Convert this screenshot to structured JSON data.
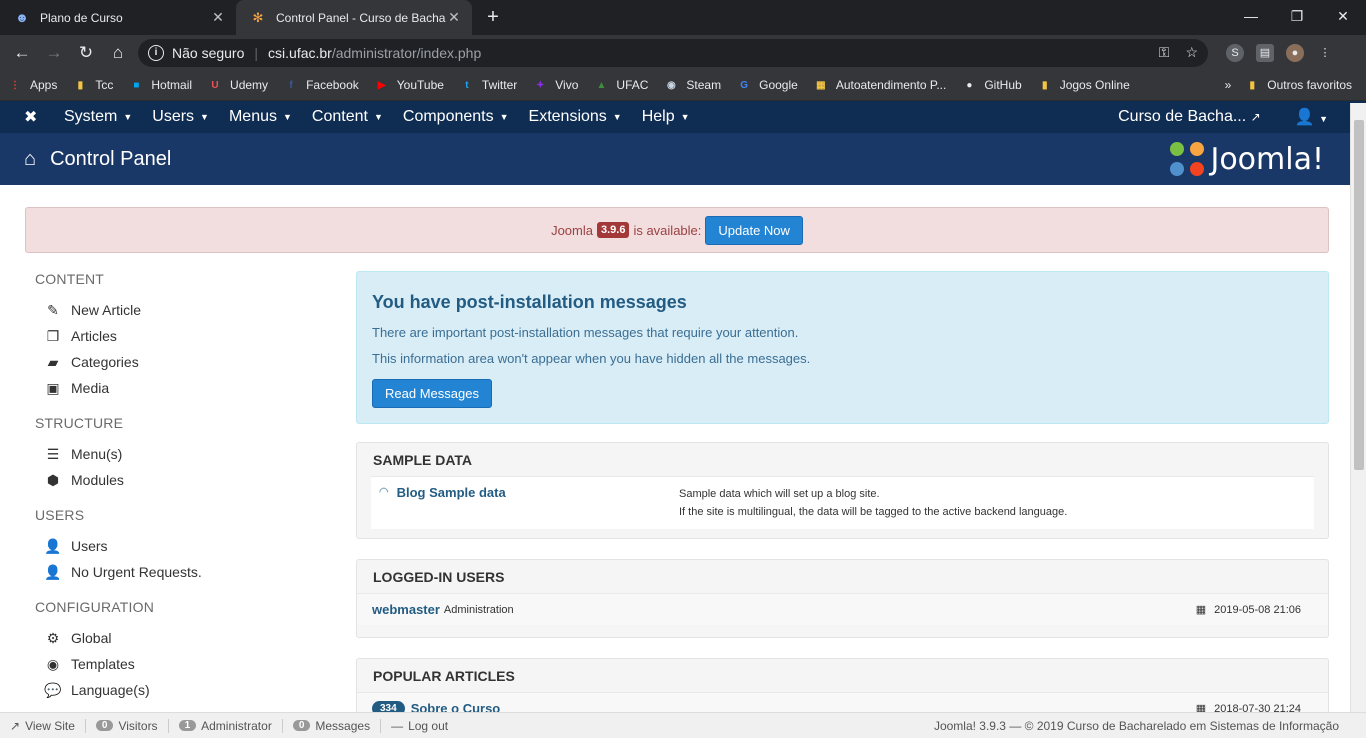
{
  "browser": {
    "tabs": [
      {
        "title": "Plano de Curso",
        "active": false
      },
      {
        "title": "Control Panel - Curso de Bachare",
        "active": true
      }
    ],
    "omnibox": {
      "security": "Não seguro",
      "host": "csi.ufac.br",
      "path": "/administrator/index.php"
    },
    "bookmarks": [
      {
        "label": "Apps",
        "icon": "apps-grid-icon",
        "color": "#ea4335"
      },
      {
        "label": "Tcc",
        "icon": "folder-icon",
        "color": "#f4c542"
      },
      {
        "label": "Hotmail",
        "icon": "microsoft-icon",
        "color": "#00a4ef"
      },
      {
        "label": "Udemy",
        "icon": "udemy-icon",
        "color": "#ec5252"
      },
      {
        "label": "Facebook",
        "icon": "facebook-icon",
        "color": "#3b5998"
      },
      {
        "label": "YouTube",
        "icon": "youtube-icon",
        "color": "#ff0000"
      },
      {
        "label": "Twitter",
        "icon": "twitter-icon",
        "color": "#1da1f2"
      },
      {
        "label": "Vivo",
        "icon": "vivo-icon",
        "color": "#8a2be2"
      },
      {
        "label": "UFAC",
        "icon": "ufac-icon",
        "color": "#3c8d3c"
      },
      {
        "label": "Steam",
        "icon": "steam-icon",
        "color": "#c7d5e0"
      },
      {
        "label": "Google",
        "icon": "google-icon",
        "color": "#4285f4"
      },
      {
        "label": "Autoatendimento P...",
        "icon": "autoatendimento-icon",
        "color": "#f4c542"
      },
      {
        "label": "GitHub",
        "icon": "github-icon",
        "color": "#e8eaed"
      },
      {
        "label": "Jogos Online",
        "icon": "bookmark-page-icon",
        "color": "#f4c542"
      }
    ],
    "more_label": "»",
    "other_bookmarks": "Outros favoritos"
  },
  "joomla": {
    "menu": [
      "System",
      "Users",
      "Menus",
      "Content",
      "Components",
      "Extensions",
      "Help"
    ],
    "site_link": "Curso de Bacha...",
    "page_title": "Control Panel",
    "brand": "Joomla!",
    "update": {
      "prefix": "Joomla",
      "version": "3.9.6",
      "suffix": "is available:",
      "button": "Update Now"
    },
    "sidebar": {
      "content": {
        "heading": "CONTENT",
        "items": [
          "New Article",
          "Articles",
          "Categories",
          "Media"
        ]
      },
      "structure": {
        "heading": "STRUCTURE",
        "items": [
          "Menu(s)",
          "Modules"
        ]
      },
      "users": {
        "heading": "USERS",
        "items": [
          "Users",
          "No Urgent Requests."
        ]
      },
      "configuration": {
        "heading": "CONFIGURATION",
        "items": [
          "Global",
          "Templates",
          "Language(s)"
        ]
      }
    },
    "post_install": {
      "title": "You have post-installation messages",
      "line1": "There are important post-installation messages that require your attention.",
      "line2": "This information area won't appear when you have hidden all the messages.",
      "button": "Read Messages"
    },
    "sample_data": {
      "heading": "SAMPLE DATA",
      "item": "Blog Sample data",
      "desc1": "Sample data which will set up a blog site.",
      "desc2": "If the site is multilingual, the data will be tagged to the active backend language."
    },
    "logged_in": {
      "heading": "LOGGED-IN USERS",
      "user": "webmaster",
      "role": "Administration",
      "date": "2019-05-08 21:06"
    },
    "popular": {
      "heading": "POPULAR ARTICLES",
      "hits": "334",
      "title": "Sobre o Curso",
      "date": "2018-07-30 21:24"
    },
    "statusbar": {
      "view_site": "View Site",
      "visitors_count": "0",
      "visitors": "Visitors",
      "admin_count": "1",
      "admin": "Administrator",
      "messages_count": "0",
      "messages": "Messages",
      "logout": "Log out",
      "copyright": "Joomla! 3.9.3  —  © 2019 Curso de Bacharelado em Sistemas de Informação"
    }
  }
}
